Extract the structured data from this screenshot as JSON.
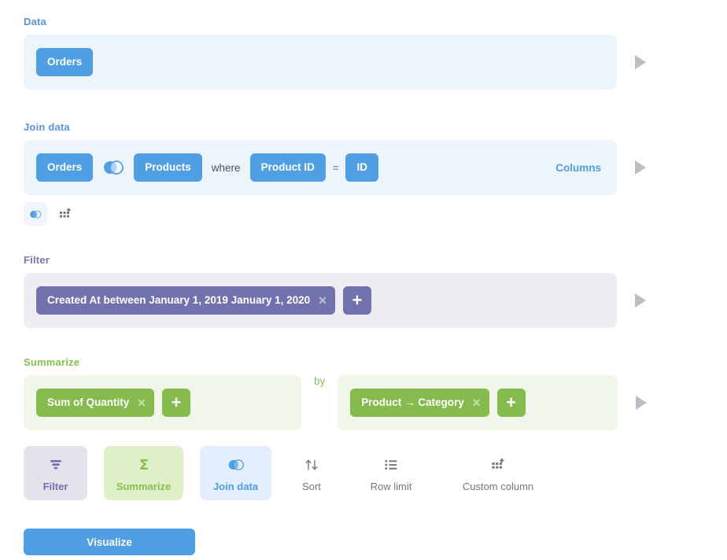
{
  "steps": {
    "data": {
      "label": "Data",
      "table": "Orders",
      "preview_icon": "play-triangle-icon"
    },
    "join": {
      "label": "Join data",
      "left_table": "Orders",
      "join_icon": "venn-join-icon",
      "right_table": "Products",
      "where_text": "where",
      "left_field": "Product ID",
      "operator": "=",
      "right_field": "ID",
      "columns_link": "Columns",
      "preview_icon": "play-triangle-icon",
      "sub_actions": [
        {
          "name": "join-data-icon",
          "icon": "venn-join-icon",
          "active": true
        },
        {
          "name": "custom-column-icon",
          "icon": "grid-plus-icon",
          "active": false
        }
      ]
    },
    "filter": {
      "label": "Filter",
      "clause": "Created At between January 1, 2019 January 1, 2020",
      "remove_icon": "close-x-icon",
      "add_label": "+",
      "preview_icon": "play-triangle-icon"
    },
    "summarize": {
      "label": "Summarize",
      "aggregation": "Sum of Quantity",
      "remove_icon": "close-x-icon",
      "add_label": "+",
      "by_text": "by",
      "breakout": "Product → Category",
      "breakout_remove_icon": "close-x-icon",
      "breakout_add_label": "+",
      "preview_icon": "play-triangle-icon"
    }
  },
  "action_bar": [
    {
      "label": "Filter",
      "icon": "funnel-icon"
    },
    {
      "label": "Summarize",
      "icon": "sigma-icon"
    },
    {
      "label": "Join data",
      "icon": "venn-join-icon"
    },
    {
      "label": "Sort",
      "icon": "sort-arrows-icon"
    },
    {
      "label": "Row limit",
      "icon": "list-icon"
    },
    {
      "label": "Custom column",
      "icon": "grid-plus-icon"
    }
  ],
  "visualize_button": "Visualize",
  "colors": {
    "blue": "#509ee3",
    "purple": "#7172ad",
    "green": "#84bb4c",
    "blue_panel": "#edf4fb",
    "purple_panel": "#ededf2",
    "green_panel": "#f0f7ea",
    "arrow_gray": "#b8bec4"
  }
}
